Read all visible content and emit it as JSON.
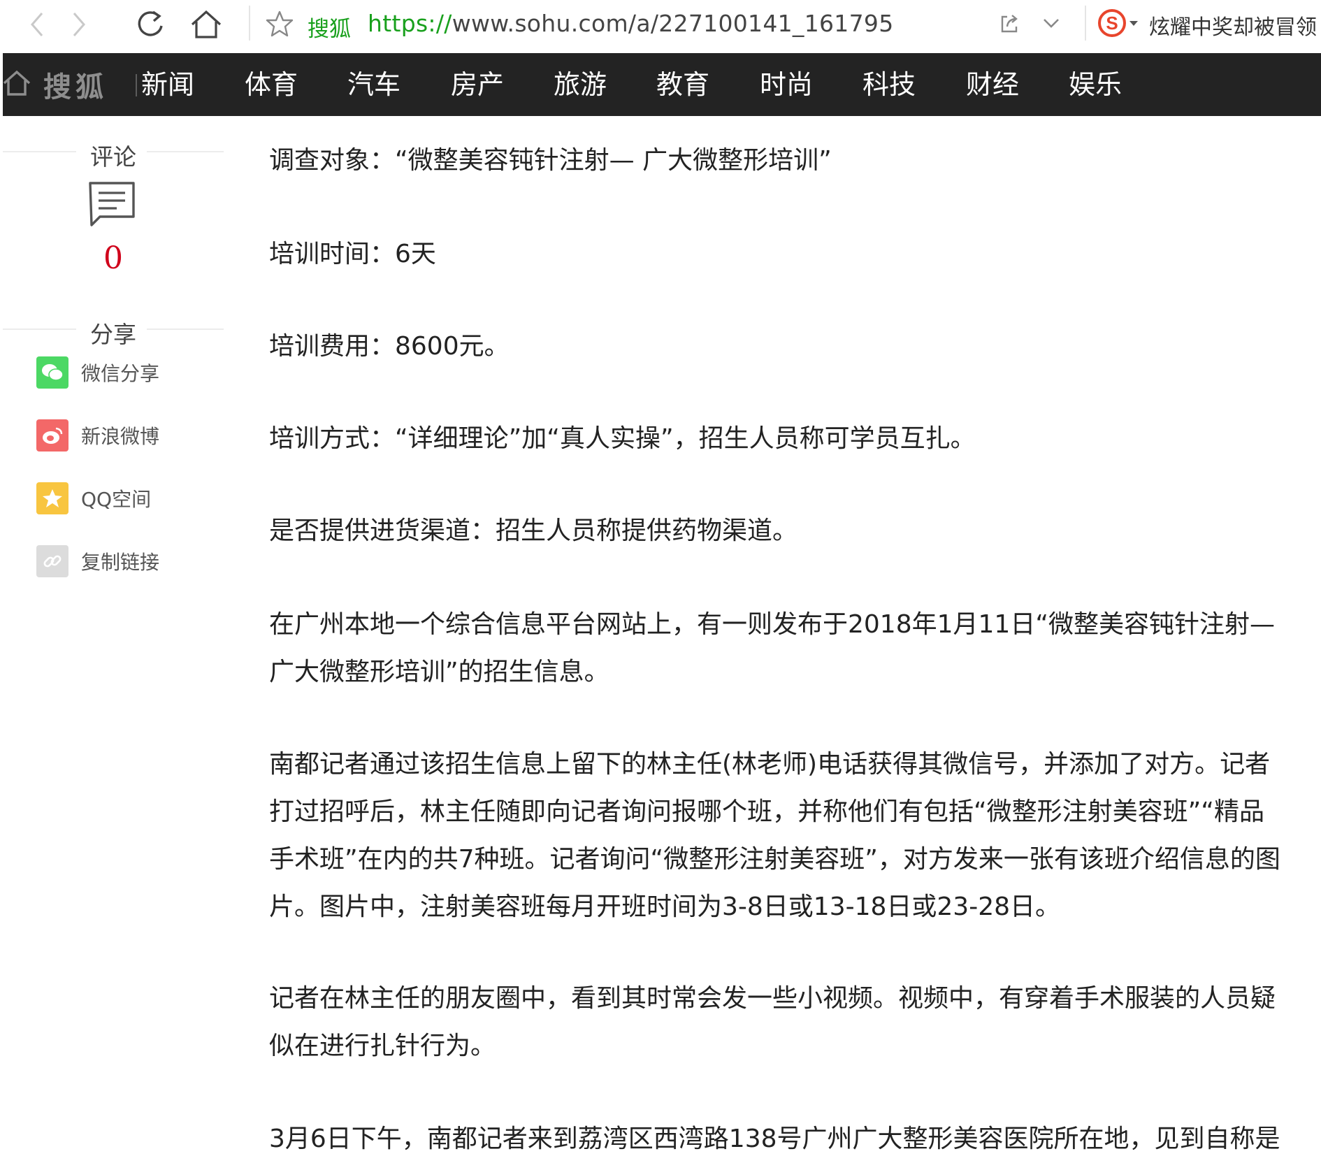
{
  "browser": {
    "site_name": "搜狐",
    "url_scheme": "https://",
    "url_rest": "www.sohu.com/a/227100141_161795",
    "extension_news": "炫耀中奖却被冒领"
  },
  "site": {
    "brand": "搜狐",
    "nav": [
      "新闻",
      "体育",
      "汽车",
      "房产",
      "旅游",
      "教育",
      "时尚",
      "科技",
      "财经",
      "娱乐"
    ]
  },
  "rail": {
    "comment_title": "评论",
    "comment_count": "0",
    "share_title": "分享",
    "share_items": [
      {
        "label": "微信分享",
        "icon": "wechat-icon",
        "color": "#4cd864"
      },
      {
        "label": "新浪微博",
        "icon": "weibo-icon",
        "color": "#f36868"
      },
      {
        "label": "QQ空间",
        "icon": "qzone-icon",
        "color": "#f8c540"
      },
      {
        "label": "复制链接",
        "icon": "link-icon",
        "color": "#dcdcdc"
      }
    ]
  },
  "article": {
    "paragraphs": [
      "调查对象：“微整美容钝针注射— 广大微整形培训”",
      "培训时间：6天",
      "培训费用：8600元。",
      "培训方式：“详细理论”加“真人实操”，招生人员称可学员互扎。",
      "是否提供进货渠道：招生人员称提供药物渠道。",
      "在广州本地一个综合信息平台网站上，有一则发布于2018年1月11日“微整美容钝针注射— 广大微整形培训”的招生信息。",
      "南都记者通过该招生信息上留下的林主任(林老师)电话获得其微信号，并添加了对方。记者打过招呼后，林主任随即向记者询问报哪个班，并称他们有包括“微整形注射美容班”“精品手术班”在内的共7种班。记者询问“微整形注射美容班”，对方发来一张有该班介绍信息的图片。图片中，注射美容班每月开班时间为3-8日或13-18日或23-28日。",
      "记者在林主任的朋友圈中，看到其时常会发一些小视频。视频中，有穿着手术服装的人员疑似在进行扎针行为。",
      "3月6日下午，南都记者来到荔湾区西湾路138号广州广大整形美容医院所在地，见到自称是"
    ]
  }
}
